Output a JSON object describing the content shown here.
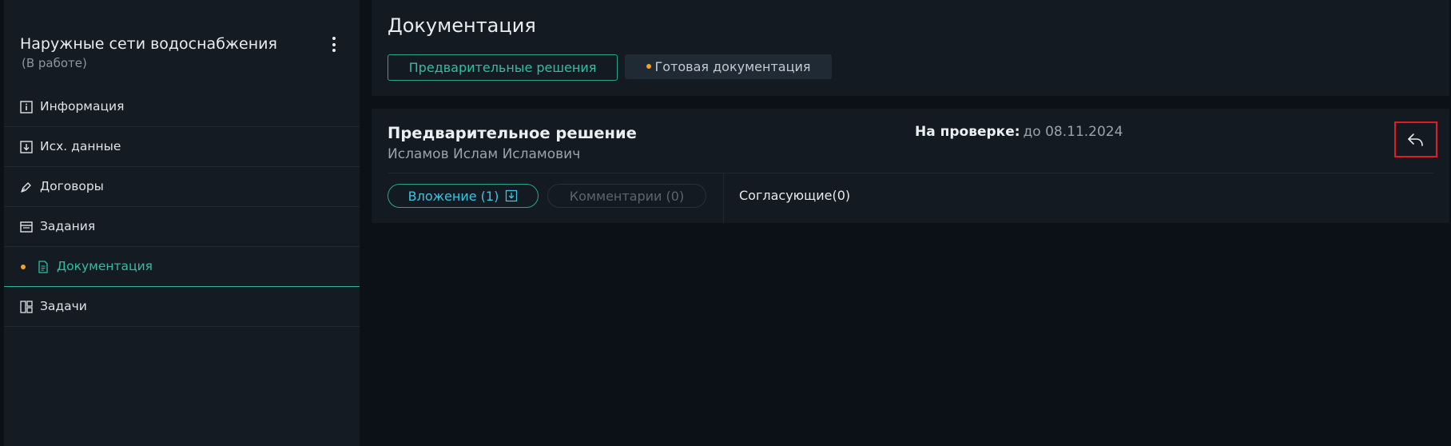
{
  "sidebar": {
    "project_title": "Наружные сети водоснабжения",
    "project_status": "(В работе)",
    "items": [
      {
        "label": "Информация",
        "icon": "info-icon"
      },
      {
        "label": "Исх. данные",
        "icon": "download-icon"
      },
      {
        "label": "Договоры",
        "icon": "pen-icon"
      },
      {
        "label": "Задания",
        "icon": "window-icon"
      },
      {
        "label": "Документация",
        "icon": "document-icon",
        "active": true
      },
      {
        "label": "Задачи",
        "icon": "layout-icon"
      }
    ]
  },
  "header": {
    "title": "Документация",
    "tabs": [
      {
        "label": "Предварительные решения",
        "active": true
      },
      {
        "label": "Готовая документация",
        "active": false
      }
    ]
  },
  "card": {
    "title": "Предварительное решение",
    "author": "Исламов Ислам Исламович",
    "review_label": "На проверке:",
    "review_date": "до 08.11.2024",
    "attachment_label": "Вложение (1)",
    "comments_label": "Комментарии (0)",
    "approvers_label": "Согласующие(0)",
    "reply_icon": "reply-icon"
  },
  "colors": {
    "accent": "#2fbfa3",
    "indicator": "#f0a32a",
    "highlight_border": "#e01b22",
    "attachment_text": "#3ec3e0"
  }
}
